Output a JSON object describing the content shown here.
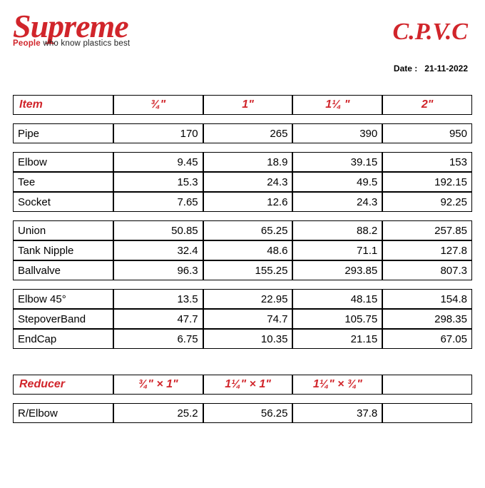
{
  "brand": "Supreme",
  "tagline_prefix": "People",
  "tagline_rest": " who know plastics best",
  "product_line": "C.P.V.C",
  "date_label": "Date :",
  "date_value": "21-11-2022",
  "main_table": {
    "item_header": "Item",
    "size_headers": [
      "¾\"",
      "1\"",
      "1¼ \"",
      "2\""
    ],
    "groups": [
      [
        {
          "name": "Pipe",
          "values": [
            "170",
            "265",
            "390",
            "950"
          ]
        }
      ],
      [
        {
          "name": "Elbow",
          "values": [
            "9.45",
            "18.9",
            "39.15",
            "153"
          ]
        },
        {
          "name": "Tee",
          "values": [
            "15.3",
            "24.3",
            "49.5",
            "192.15"
          ]
        },
        {
          "name": "Socket",
          "values": [
            "7.65",
            "12.6",
            "24.3",
            "92.25"
          ]
        }
      ],
      [
        {
          "name": "Union",
          "values": [
            "50.85",
            "65.25",
            "88.2",
            "257.85"
          ]
        },
        {
          "name": "Tank Nipple",
          "values": [
            "32.4",
            "48.6",
            "71.1",
            "127.8"
          ]
        },
        {
          "name": "Ballvalve",
          "values": [
            "96.3",
            "155.25",
            "293.85",
            "807.3"
          ]
        }
      ],
      [
        {
          "name": "Elbow 45°",
          "values": [
            "13.5",
            "22.95",
            "48.15",
            "154.8"
          ]
        },
        {
          "name": "StepoverBand",
          "values": [
            "47.7",
            "74.7",
            "105.75",
            "298.35"
          ]
        },
        {
          "name": "EndCap",
          "values": [
            "6.75",
            "10.35",
            "21.15",
            "67.05"
          ]
        }
      ]
    ]
  },
  "reducer_table": {
    "item_header": "Reducer",
    "size_headers": [
      "¾\" × 1\"",
      "1¼\" × 1\"",
      "1¼\" × ¾\"",
      ""
    ],
    "rows": [
      {
        "name": "R/Elbow",
        "values": [
          "25.2",
          "56.25",
          "37.8",
          ""
        ]
      }
    ]
  }
}
